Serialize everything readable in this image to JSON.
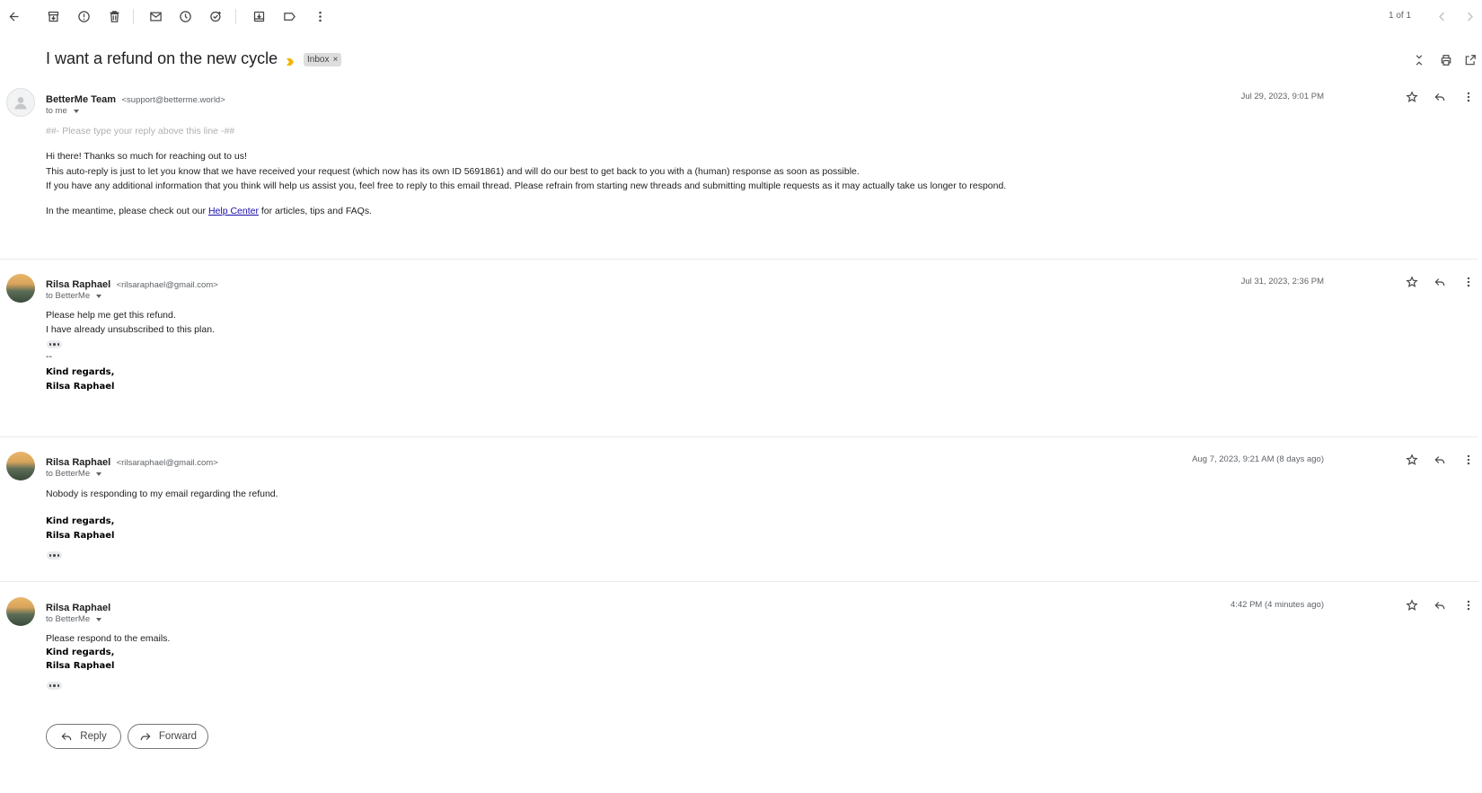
{
  "toolbar": {
    "icons": [
      "back-arrow-icon",
      "archive-icon",
      "report-spam-icon",
      "delete-icon",
      "mark-unread-icon",
      "snooze-icon",
      "add-task-icon",
      "move-to-icon",
      "label-icon",
      "more-vert-icon"
    ],
    "pager": "1 of 1"
  },
  "thread": {
    "subject": "I want a refund on the new cycle",
    "label": "Inbox",
    "label_remove": "×",
    "importance_color": "#f4b400"
  },
  "messages": [
    {
      "sender_name": "BetterMe Team",
      "sender_email": "<support@betterme.world>",
      "to": "to me",
      "date": "Jul 29, 2023, 9:01 PM",
      "body": [
        "##- Please type your reply above this line -##",
        "Hi there! Thanks so much for reaching out to us!",
        "This auto-reply is just to let you know that we have received your request (which now has its own ID 5691861) and will do our best to get back to you with a (human) response as soon as possible.",
        "If you have any additional information that you think will help us assist you, feel free to reply to this email thread. Please refrain from starting new threads and submitting multiple requests as it may actually take us longer to respond."
      ],
      "meantime_prefix": "In the meantime, please check out our ",
      "meantime_link": "Help Center",
      "meantime_suffix": " for articles, tips and FAQs."
    },
    {
      "sender_name": "Rilsa Raphael",
      "sender_email": "<rilsaraphael@gmail.com>",
      "to": "to BetterMe",
      "date": "Jul 31, 2023, 2:36 PM",
      "body": [
        "Please help me get this refund.",
        "I have already unsubscribed to this plan."
      ],
      "sig_sep": "--",
      "signature": [
        "Kind regards,",
        "Rilsa Raphael"
      ]
    },
    {
      "sender_name": "Rilsa Raphael",
      "sender_email": "<rilsaraphael@gmail.com>",
      "to": "to BetterMe",
      "date": "Aug 7, 2023, 9:21 AM (8 days ago)",
      "body": [
        "Nobody is responding to my email regarding the refund."
      ],
      "signature": [
        "Kind regards,",
        "Rilsa Raphael"
      ]
    },
    {
      "sender_name": "Rilsa Raphael",
      "to": "to BetterMe",
      "date": "4:42 PM (4 minutes ago)",
      "body": [
        "Please respond to the emails."
      ],
      "signature": [
        "Kind regards,",
        "Rilsa Raphael"
      ]
    }
  ],
  "actions": {
    "reply": "Reply",
    "forward": "Forward"
  }
}
